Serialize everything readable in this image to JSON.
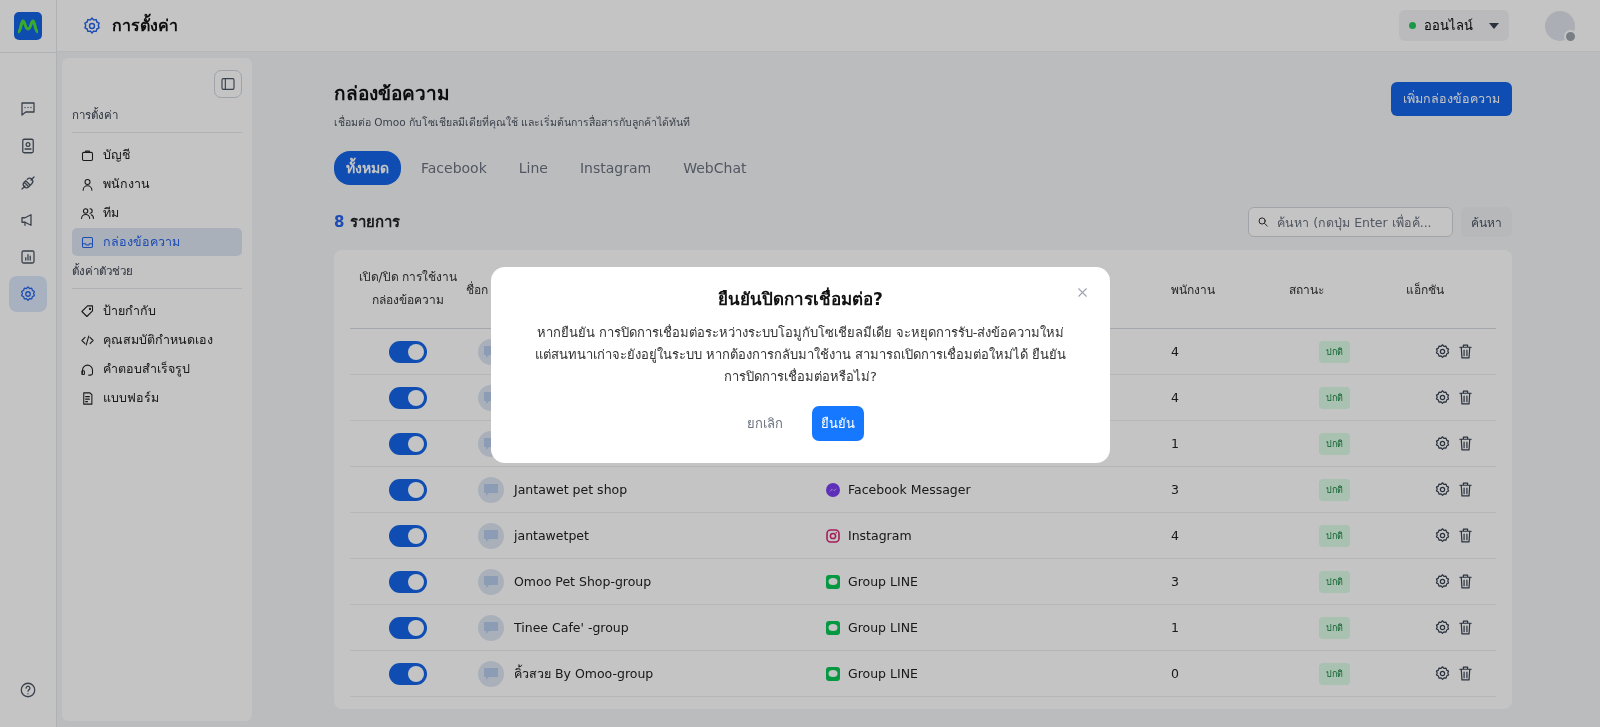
{
  "topbar": {
    "title": "การตั้งค่า",
    "status": {
      "label": "ออนไลน์",
      "color": "#1a9847"
    }
  },
  "rail": [
    {
      "kind": "chat",
      "selected": false
    },
    {
      "kind": "contact",
      "selected": false
    },
    {
      "kind": "plug",
      "selected": false
    },
    {
      "kind": "megaphone",
      "selected": false
    },
    {
      "kind": "chart",
      "selected": false
    },
    {
      "kind": "settings",
      "selected": true
    },
    {
      "kind": "help",
      "selected": false
    }
  ],
  "sidebar": {
    "sections": [
      {
        "heading": "การตั้งค่า",
        "items": [
          {
            "label": "บัญชี",
            "kind": "bag",
            "selected": false
          },
          {
            "label": "พนักงาน",
            "kind": "user",
            "selected": false
          },
          {
            "label": "ทีม",
            "kind": "users",
            "selected": false
          },
          {
            "label": "กล่องข้อความ",
            "kind": "inbox",
            "selected": true
          }
        ]
      },
      {
        "heading": "ตั้งค่าตัวช่วย",
        "items": [
          {
            "label": "ป้ายกำกับ",
            "kind": "tag",
            "selected": false
          },
          {
            "label": "คุณสมบัติกำหนดเอง",
            "kind": "code",
            "selected": false
          },
          {
            "label": "คำตอบสำเร็จรูป",
            "kind": "headset",
            "selected": false
          },
          {
            "label": "แบบฟอร์ม",
            "kind": "form",
            "selected": false
          }
        ]
      }
    ]
  },
  "page": {
    "title": "กล่องข้อความ",
    "subtitle": "เชื่อมต่อ Omoo กับโซเชียลมีเดียที่คุณใช้ และเริ่มต้นการสื่อสารกับลูกค้าได้ทันที",
    "add_button": "เพิ่มกล่องข้อความ"
  },
  "tabs": [
    {
      "label": "ทั้งหมด",
      "selected": true
    },
    {
      "label": "Facebook",
      "selected": false
    },
    {
      "label": "Line",
      "selected": false
    },
    {
      "label": "Instagram",
      "selected": false
    },
    {
      "label": "WebChat",
      "selected": false
    }
  ],
  "count": {
    "number": "8",
    "label": "รายการ"
  },
  "search": {
    "placeholder": "ค้นหา (กดปุ่ม Enter เพื่อค้...",
    "button": "ค้นหา"
  },
  "table": {
    "columns": [
      "เปิด/ปิด การใช้งานกล่องข้อความ",
      "ชื่อก",
      "",
      "พนักงาน",
      "สถานะ",
      "แอ็กชัน"
    ],
    "rows": [
      {
        "enabled": true,
        "staff": "4",
        "status": "ปกติ"
      },
      {
        "enabled": true,
        "staff": "4",
        "status": "ปกติ"
      },
      {
        "enabled": true,
        "staff": "1",
        "status": "ปกติ"
      },
      {
        "enabled": true,
        "name": "Jantawet pet shop",
        "channel": {
          "kind": "messenger",
          "label": "Facebook Messager"
        },
        "staff": "3",
        "status": "ปกติ"
      },
      {
        "enabled": true,
        "name": "jantawetpet",
        "channel": {
          "kind": "instagram",
          "label": "Instagram"
        },
        "staff": "4",
        "status": "ปกติ"
      },
      {
        "enabled": true,
        "name": "Omoo Pet Shop-group",
        "channel": {
          "kind": "line",
          "label": "Group LINE"
        },
        "staff": "3",
        "status": "ปกติ"
      },
      {
        "enabled": true,
        "name": "Tinee Cafe' -group",
        "channel": {
          "kind": "line",
          "label": "Group LINE"
        },
        "staff": "1",
        "status": "ปกติ"
      },
      {
        "enabled": true,
        "name": "คิ้วสวย By Omoo-group",
        "channel": {
          "kind": "line",
          "label": "Group LINE"
        },
        "staff": "0",
        "status": "ปกติ"
      }
    ]
  },
  "dialog": {
    "title": "ยืนยันปิดการเชื่อมต่อ?",
    "message": "หากยืนยัน การปิดการเชื่อมต่อระหว่างระบบโอมูกับโซเชียลมีเดีย จะหยุดการรับ-ส่งข้อความใหม่ แต่สนทนาเก่าจะยังอยู่ในระบบ หากต้องการกลับมาใช้งาน สามารถเปิดการเชื่อมต่อใหม่ได้ ยืนยันการปิดการเชื่อมต่อหรือไม่?",
    "cancel": "ยกเลิก",
    "confirm": "ยืนยัน"
  }
}
